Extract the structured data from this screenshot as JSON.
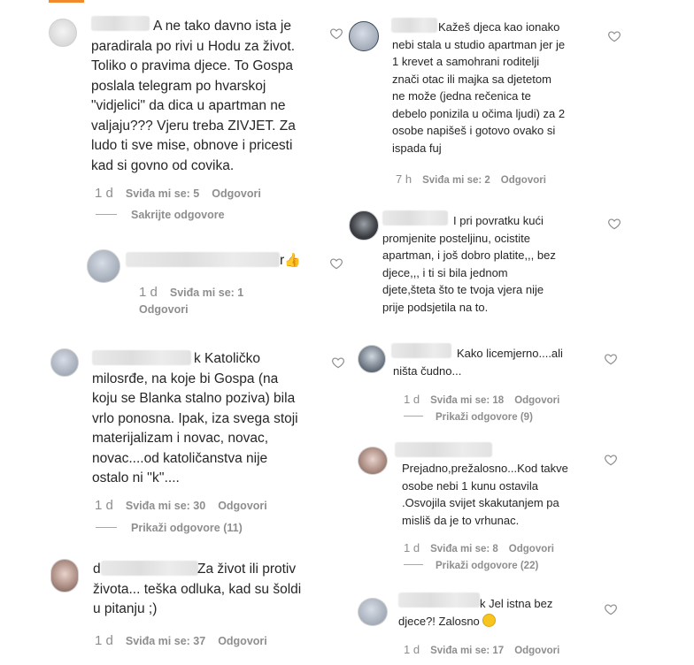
{
  "ui": {
    "like_label": "Sviđa mi se",
    "reply_label": "Odgovori"
  },
  "left": [
    {
      "text": "A ne tako davno ista je\nparadirala po rivi u Hodu za život.\nToliko o pravima djece. To Gospa\nposlala telegram po hvarskoj\n\"vidjelici\" da dica u apartman ne\nvaljaju??? Vjeru treba ZIVJET. Za\nludo ti sve mise, obnove i pricesti\nkad si govno od covika.",
      "age": "1 d",
      "likes": "Sviđa mi se: 5",
      "reply": "Odgovori",
      "thread": "Sakrijte odgovore"
    },
    {
      "text": "r",
      "emoji": "👍",
      "age": "1 d",
      "likes": "Sviđa mi se: 1",
      "reply": "Odgovori"
    },
    {
      "text": "k Katoličko\nmilosrđe, na koje bi Gospa (na\nkoju se Blanka stalno poziva) bila\nvrlo ponosna. Ipak, iza svega stoji\nmaterijalizam i novac, novac,\nnovac....od katoličanstva nije\nostalo ni ''k''....",
      "age": "1 d",
      "likes": "Sviđa mi se: 30",
      "reply": "Odgovori",
      "thread": "Prikaži odgovore (11)"
    },
    {
      "text_first": "d",
      "text": "Za život ili protiv\nživota... teška odluka, kad su šoldi\nu pitanju ;)",
      "age": "1 d",
      "likes": "Sviđa mi se: 37",
      "reply": "Odgovori"
    }
  ],
  "right": [
    {
      "text": "Kažeš djeca kao ionako\nnebi stala u studio apartman jer je\n1 krevet a samohrani roditelji\nznači otac ili majka sa djetetom\nne može (jedna rečenica te\ndebelo ponizila u očima ljudi) za 2\nosobe napišeš i gotovo ovako si\nispada fuj",
      "age": "7 h",
      "likes": "Sviđa mi se: 2",
      "reply": "Odgovori"
    },
    {
      "text": "I pri povratku kući\npromjenite posteljinu, ocistite\napartman, i još dobro platite,,, bez\ndjece,,, i ti si bila jednom\ndjete,šteta što te tvoja vjera nije\nprije podsjetila na to."
    },
    {
      "text": "Kako licemjerno....ali\nništa čudno...",
      "age": "1 d",
      "likes": "Sviđa mi se: 18",
      "reply": "Odgovori",
      "thread": "Prikaži odgovore (9)"
    },
    {
      "text": "Prejadno,prežalosno...Kod takve\nosobe nebi 1 kunu ostavila\n.Osvojila svijet skakutanjem pa\nmisliš da je to vrhunac.",
      "age": "1 d",
      "likes": "Sviđa mi se: 8",
      "reply": "Odgovori",
      "thread": "Prikaži odgovore (22)"
    },
    {
      "text": "k Jel istna bez\ndjece?! Zalosno",
      "age": "1 d",
      "likes": "Sviđa mi se: 17",
      "reply": "Odgovori"
    }
  ]
}
